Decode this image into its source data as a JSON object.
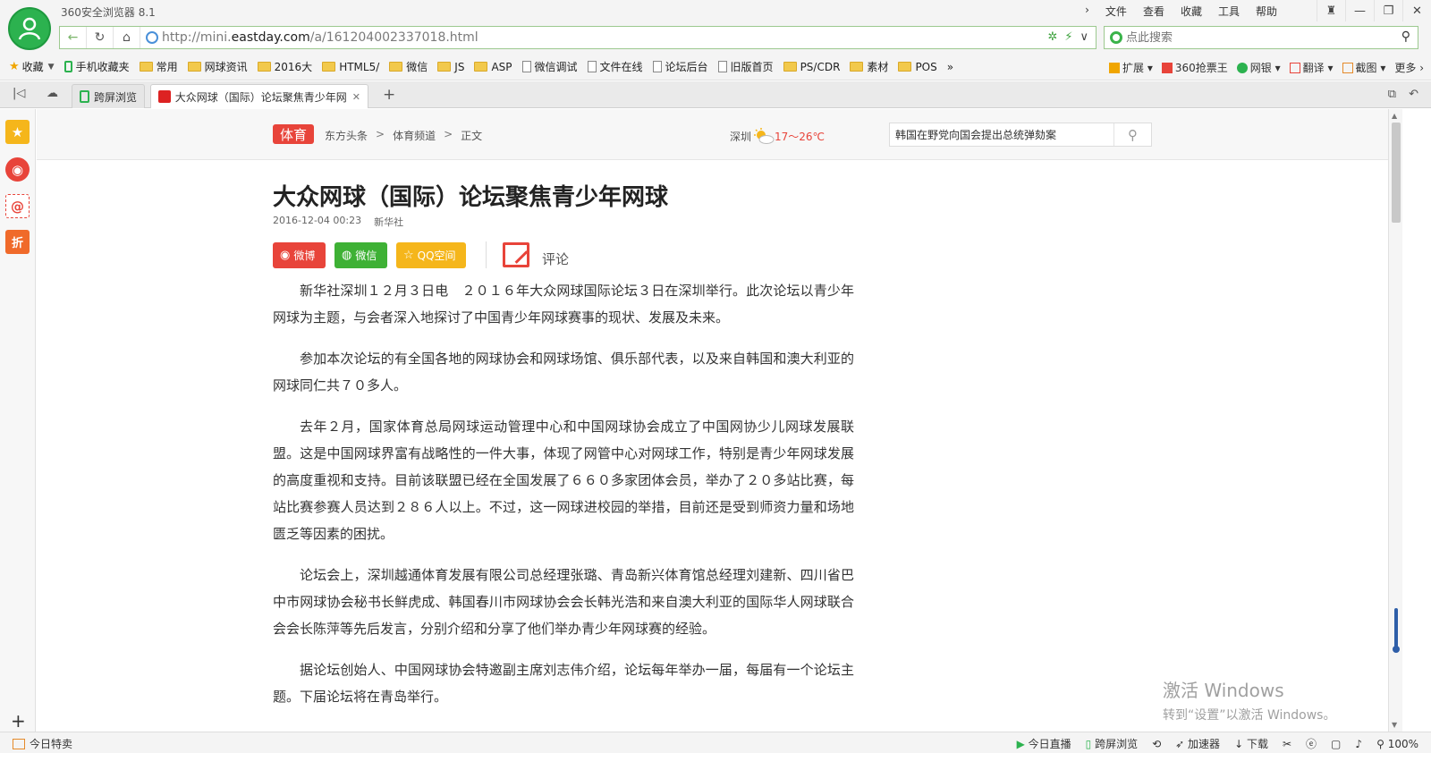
{
  "app": {
    "title": "360安全浏览器 8.1",
    "menu": [
      "文件",
      "查看",
      "收藏",
      "工具",
      "帮助"
    ]
  },
  "address": {
    "url_prefix": "http://mini.",
    "url_domain": "eastday.com",
    "url_path": "/a/161204002337018.html",
    "search_placeholder": "点此搜索"
  },
  "bookmarks": {
    "collect_label": "收藏",
    "items": [
      {
        "label": "手机收藏夹",
        "icon": "phone-icon"
      },
      {
        "label": "常用",
        "icon": "folder-icon"
      },
      {
        "label": "网球资讯",
        "icon": "folder-icon"
      },
      {
        "label": "2016大",
        "icon": "folder-icon"
      },
      {
        "label": "HTML5/",
        "icon": "folder-icon"
      },
      {
        "label": "微信",
        "icon": "folder-icon"
      },
      {
        "label": "JS",
        "icon": "folder-icon"
      },
      {
        "label": "ASP",
        "icon": "folder-icon"
      },
      {
        "label": "微信调试",
        "icon": "page-icon"
      },
      {
        "label": "文件在线",
        "icon": "page-icon"
      },
      {
        "label": "论坛后台",
        "icon": "page-icon"
      },
      {
        "label": "旧版首页",
        "icon": "page-icon"
      },
      {
        "label": "PS/CDR",
        "icon": "folder-icon"
      },
      {
        "label": "素材",
        "icon": "folder-icon"
      },
      {
        "label": "POS",
        "icon": "folder-icon"
      }
    ],
    "more": "»",
    "right": [
      "扩展",
      "360抢票王",
      "网银",
      "翻译",
      "截图",
      "更多"
    ]
  },
  "tabs": [
    {
      "label": "跨屏浏览"
    },
    {
      "label": "大众网球（国际）论坛聚焦青少年网球"
    }
  ],
  "site": {
    "category": "体育",
    "breadcrumb": [
      "东方头条",
      "体育频道",
      "正文"
    ],
    "city": "深圳",
    "temperature": "17～26℃",
    "search_value": "韩国在野党向国会提出总统弹劾案"
  },
  "article": {
    "title": "大众网球（国际）论坛聚焦青少年网球",
    "date": "2016-12-04 00:23",
    "source": "新华社",
    "share": {
      "weibo": "微博",
      "wechat": "微信",
      "qq": "QQ空间",
      "comment": "评论"
    },
    "paragraphs": [
      "新华社深圳１２月３日电　２０１６年大众网球国际论坛３日在深圳举行。此次论坛以青少年网球为主题，与会者深入地探讨了中国青少年网球赛事的现状、发展及未来。",
      "参加本次论坛的有全国各地的网球协会和网球场馆、俱乐部代表，以及来自韩国和澳大利亚的网球同仁共７０多人。",
      "去年２月，国家体育总局网球运动管理中心和中国网球协会成立了中国网协少儿网球发展联盟。这是中国网球界富有战略性的一件大事，体现了网管中心对网球工作，特别是青少年网球发展的高度重视和支持。目前该联盟已经在全国发展了６６０多家团体会员，举办了２０多站比赛，每站比赛参赛人员达到２８６人以上。不过，这一网球进校园的举措，目前还是受到师资力量和场地匮乏等因素的困扰。",
      "论坛会上，深圳越通体育发展有限公司总经理张璐、青岛新兴体育馆总经理刘建新、四川省巴中市网球协会秘书长鲜虎成、韩国春川市网球协会会长韩光浩和来自澳大利亚的国际华人网球联合会会长陈萍等先后发言，分别介绍和分享了他们举办青少年网球赛的经验。",
      "据论坛创始人、中国网球协会特邀副主席刘志伟介绍，论坛每年举办一届，每届有一个论坛主题。下届论坛将在青岛举行。"
    ]
  },
  "watermark": {
    "line1": "激活 Windows",
    "line2": "转到“设置”以激活 Windows。"
  },
  "status": {
    "left": "今日特卖",
    "right": [
      "今日直播",
      "跨屏浏览",
      "加速器",
      "下载"
    ],
    "zoom": "100%"
  },
  "colors": {
    "brand_green": "#2cb24f",
    "accent_red": "#e8443a"
  }
}
